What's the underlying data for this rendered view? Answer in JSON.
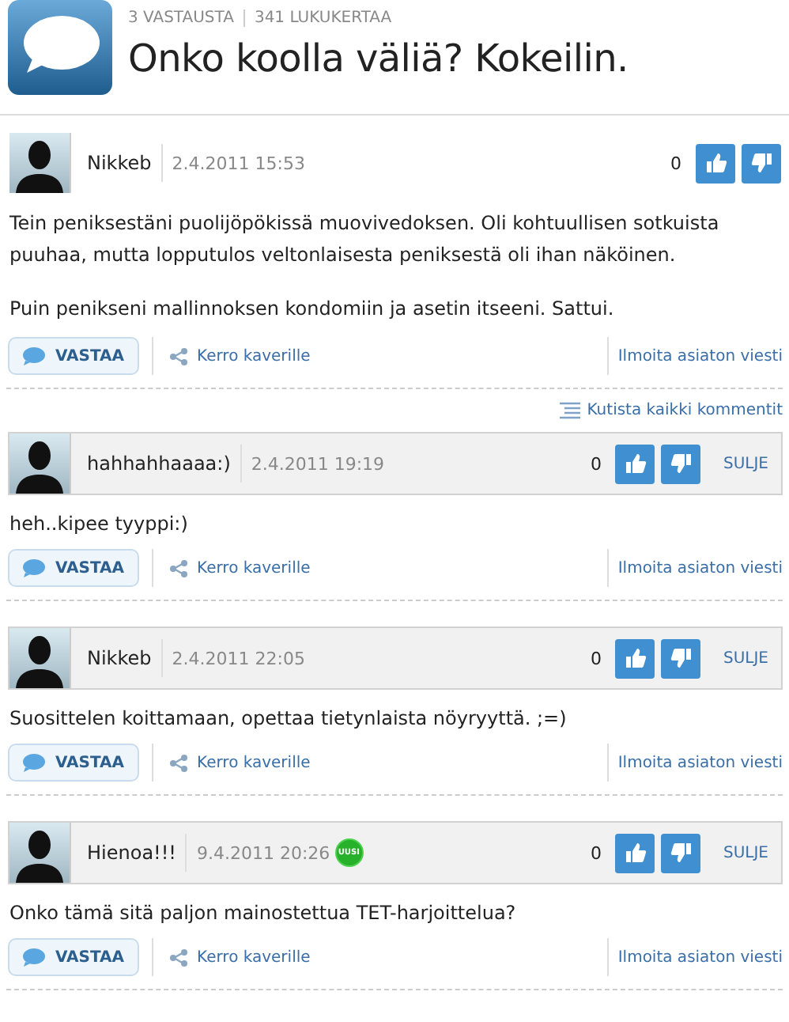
{
  "thread": {
    "replies": "3 VASTAUSTA",
    "reads": "341 LUKUKERTAA",
    "title": "Onko koolla väliä? Kokeilin."
  },
  "post": {
    "author": "Nikkeb",
    "date": "2.4.2011 15:53",
    "votes": "0",
    "paragraphs": [
      "Tein peniksestäni puolijöpökissä muovivedoksen. Oli kohtuullisen sotkuista puuhaa, mutta lopputulos veltonlaisesta peniksestä oli ihan näköinen.",
      "Puin penikseni mallinnoksen kondomiin ja asetin itseeni. Sattui."
    ],
    "reply": "VASTAA",
    "share": "Kerro kaverille",
    "report": "Ilmoita asiaton viesti"
  },
  "collapse_all": "Kutista kaikki kommentit",
  "comments": [
    {
      "author": "hahhahhaaaa:)",
      "date": "2.4.2011 19:19",
      "new": false,
      "votes": "0",
      "close": "SULJE",
      "text": "heh..kipee tyyppi:)",
      "reply": "VASTAA",
      "share": "Kerro kaverille",
      "report": "Ilmoita asiaton viesti"
    },
    {
      "author": "Nikkeb",
      "date": "2.4.2011 22:05",
      "new": false,
      "votes": "0",
      "close": "SULJE",
      "text": "Suosittelen koittamaan, opettaa tietynlaista nöyryyttä. ;=)",
      "reply": "VASTAA",
      "share": "Kerro kaverille",
      "report": "Ilmoita asiaton viesti"
    },
    {
      "author": "Hienoa!!!",
      "date": "9.4.2011 20:26",
      "new": true,
      "new_label": "UUSI",
      "votes": "0",
      "close": "SULJE",
      "text": "Onko tämä sitä paljon mainostettua TET-harjoittelua?",
      "reply": "VASTAA",
      "share": "Kerro kaverille",
      "report": "Ilmoita asiaton viesti"
    }
  ]
}
